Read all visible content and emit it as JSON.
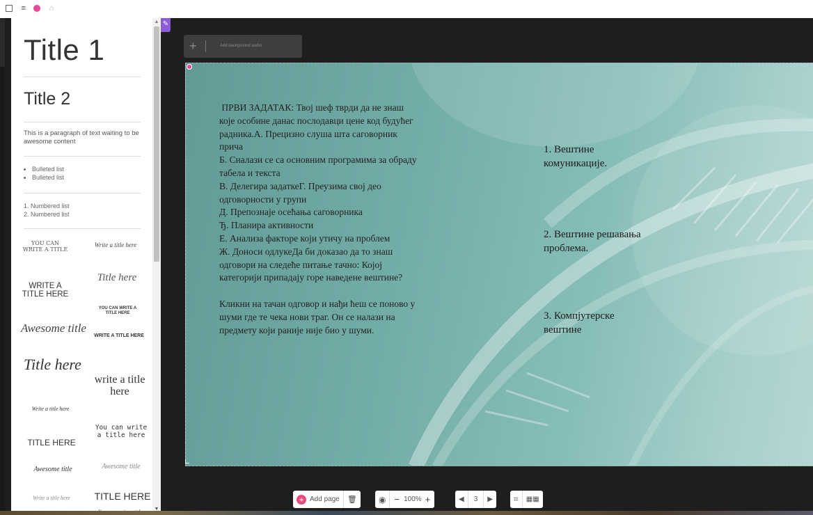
{
  "top_toolbar": {
    "icons": [
      "square-icon",
      "menu-icon",
      "badge-icon",
      "lock-icon"
    ]
  },
  "left_panel": {
    "title1": "Title 1",
    "title2": "Title 2",
    "paragraph": "This is a paragraph of text waiting to be awesome content",
    "bulleted": [
      "Bulleted list",
      "Bulleted list"
    ],
    "numbered": [
      "1. Numbered list",
      "2. Numbered list"
    ],
    "templates": [
      "YOU CAN WRITE A TITLE",
      "Write a title here",
      "WRITE A TITLE HERE",
      "Title here",
      "YOU CAN WRITE A TITLE HERE",
      "Awesome title",
      "WRITE A TITLE HERE",
      "Title here",
      "write a title here",
      "Write a title here",
      "TITLE HERE",
      "You can write a title here",
      "Awesome title",
      "Awesome title",
      "Write a title here",
      "TITLE HERE",
      "You can write a title here"
    ]
  },
  "canvas": {
    "audio_button": {
      "plus": "+",
      "label": "Add background audio"
    },
    "task_text": " ПРВИ ЗАДАТАК: Твој шеф тврди да не знаш које особине данас послодавци цене код будућег радника.А. Прецизно слуша шта саговорник прича\nБ. Сналази се са основним програмима за обраду табела и текста\nВ. Делегира задаткеГ. Преузима свој део одговорности у групи\nД. Препознаје осећања саговорника\nЂ. Планира активности\nЕ. Анализа факторе који утичу на проблем\nЖ. Доноси одлукеДа би доказао да то знаш одговори на следеће питање тачно: Којој категорији припадају горе наведене вештине?\n\nКликни на тачан одговор и нађи ћеш се поново у шуми где те чека нови траг. Он се налази на предмету који раније није био у шуми.",
    "answers": [
      "1. Вештине\nкомуникације.",
      "2. Вештине решавања\nпроблема.",
      "3. Компјутерске\nвештине"
    ]
  },
  "bottom_toolbar": {
    "add_page_label": "Add page",
    "zoom_minus": "−",
    "zoom_level": "100%",
    "zoom_plus": "+",
    "page_number": "3"
  },
  "colors": {
    "dark_bg": "#1e1e1e",
    "accent_pink": "#e84a7a",
    "pin_purple": "#8a5cd6",
    "slide_teal": "#73ada8"
  }
}
